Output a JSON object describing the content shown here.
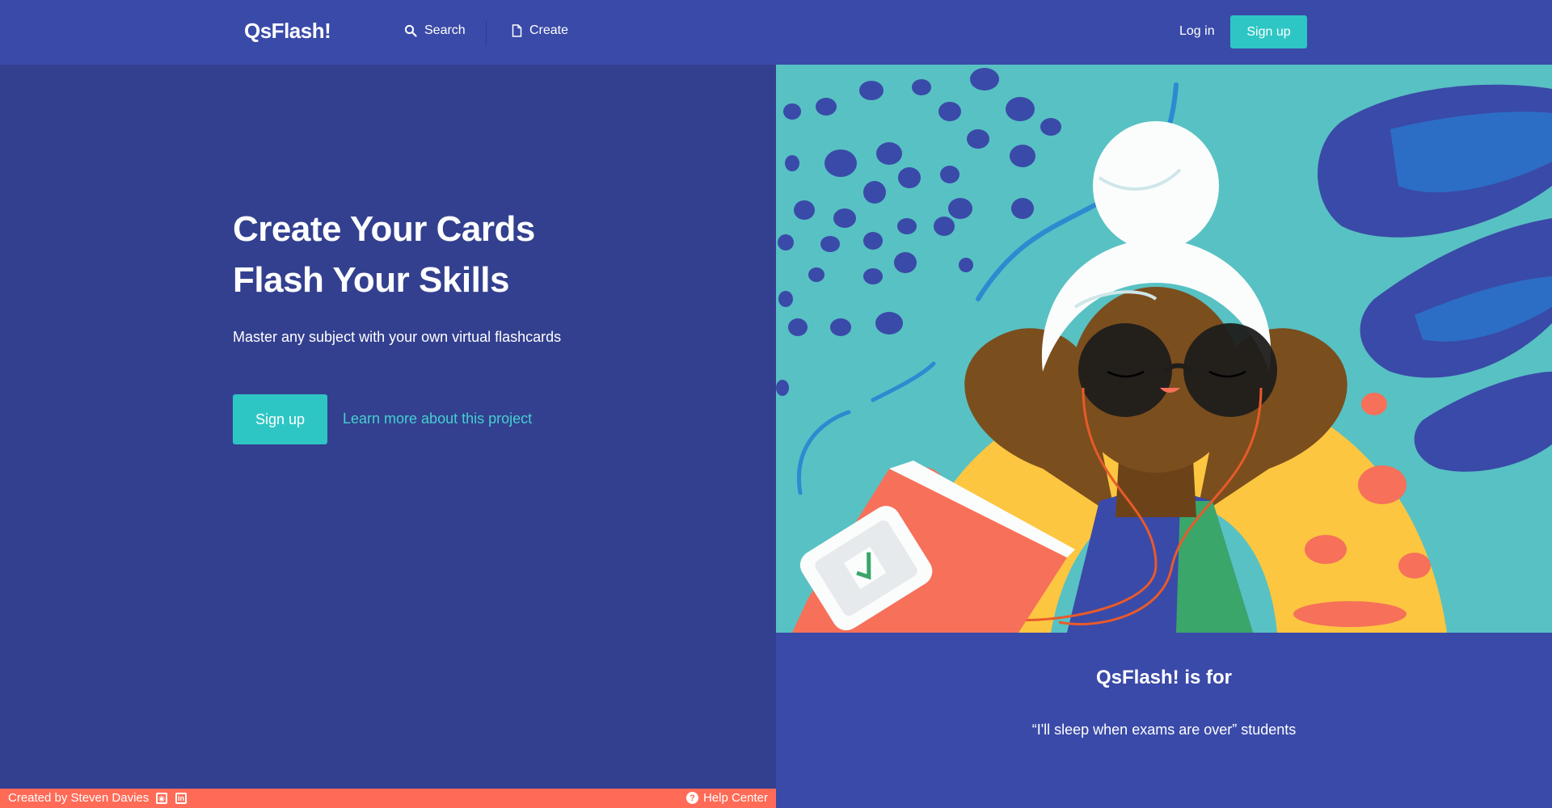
{
  "nav": {
    "brand": "QsFlash!",
    "search_label": "Search",
    "create_label": "Create",
    "login_label": "Log in",
    "signup_label": "Sign up",
    "search_icon": "search-icon",
    "create_icon": "document-icon"
  },
  "hero": {
    "title_line1": "Create Your Cards",
    "title_line2": "Flash Your Skills",
    "subtitle": "Master any subject with your own virtual flashcards",
    "signup_label": "Sign up",
    "learn_more_label": "Learn more about this project"
  },
  "tagline": {
    "title": "QsFlash! is for",
    "text": "“I'll sleep when exams are over” students"
  },
  "footer": {
    "credit": "Created by Steven Davies",
    "github_icon": "github-icon",
    "linkedin_icon": "linkedin-icon",
    "help_label": "Help Center",
    "help_icon": "question-circle-icon"
  },
  "colors": {
    "nav_bg": "#3a4aa8",
    "hero_bg": "#33408f",
    "accent": "#2ec6c4",
    "link": "#46cfd1",
    "footer_bg": "#ff6b57",
    "illustration_bg": "#58c1c3"
  }
}
